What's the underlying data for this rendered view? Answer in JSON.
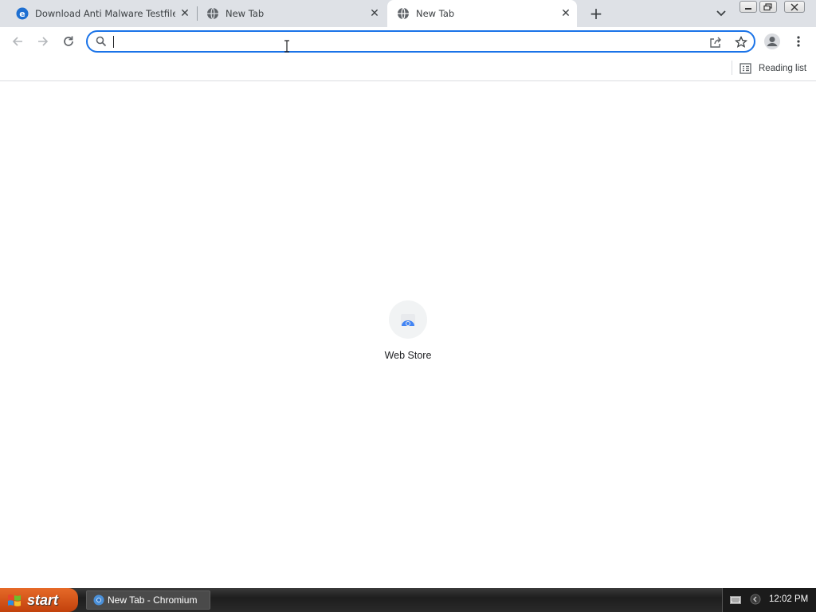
{
  "window": {
    "taskbar_title": "New Tab - Chromium"
  },
  "tabs": [
    {
      "title": "Download Anti Malware Testfile – Ei",
      "favicon": "edge-icon",
      "active": false
    },
    {
      "title": "New Tab",
      "favicon": "globe-icon",
      "active": false
    },
    {
      "title": "New Tab",
      "favicon": "globe-icon",
      "active": true
    }
  ],
  "toolbar": {
    "omnibox_value": "",
    "omnibox_placeholder": ""
  },
  "bookmarks_bar": {
    "reading_list_label": "Reading list"
  },
  "new_tab_page": {
    "shortcuts": [
      {
        "label": "Web Store",
        "icon": "web-store-icon"
      }
    ]
  },
  "taskbar": {
    "start_label": "start",
    "task_label": "New Tab - Chromium",
    "clock": "12:02 PM"
  },
  "colors": {
    "accent": "#1a73e8",
    "tabstrip": "#dee1e6",
    "start_button": "#d9531e"
  }
}
